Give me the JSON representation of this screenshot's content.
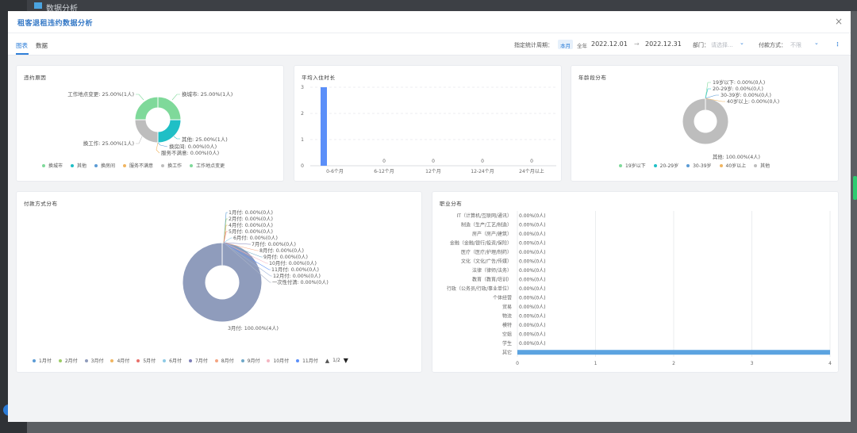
{
  "background": {
    "title": "数据分析"
  },
  "modal": {
    "title": "租客退租违约数据分析",
    "close": "×"
  },
  "toolbar": {
    "tabs": [
      "图表",
      "数据"
    ],
    "period_label": "指定统计周期：",
    "period_options": [
      "本月",
      "全年"
    ],
    "date_start": "2022.12.01",
    "date_arrow": "→",
    "date_end": "2022.12.31",
    "dept_label": "部门：",
    "dept_placeholder": "请选择...",
    "pay_label": "付款方式：",
    "pay_placeholder": "不限",
    "more": "⋮"
  },
  "colors": {
    "accent": "#2f7fd8",
    "teal": "#1fbfc6",
    "green": "#7fd99a",
    "gray": "#bdbdbd",
    "slate": "#8f9cbc",
    "blue": "#5b8ff9"
  },
  "cards": {
    "breach": {
      "title": "违约原因"
    },
    "avg_stay": {
      "title": "平均入住时长"
    },
    "age": {
      "title": "年龄段分布"
    },
    "payment": {
      "title": "付款方式分布"
    },
    "job": {
      "title": "职业分布"
    }
  },
  "chart_data": [
    {
      "type": "pie",
      "title": "违约原因",
      "slices": [
        {
          "name": "换城市",
          "value": 1,
          "label": "换城市: 25.00%(1人)",
          "color": "#7fd99a"
        },
        {
          "name": "其他",
          "value": 1,
          "label": "其他: 25.00%(1人)",
          "color": "#1fbfc6"
        },
        {
          "name": "换房间",
          "value": 0,
          "label": "换房间: 0.00%(0人)",
          "color": "#5b9bd5"
        },
        {
          "name": "服务不满意",
          "value": 0,
          "label": "服务不满意: 0.00%(0人)",
          "color": "#f0b560"
        },
        {
          "name": "换工作",
          "value": 1,
          "label": "换工作: 25.00%(1人)",
          "color": "#bdbdbd"
        },
        {
          "name": "工作地点变更",
          "value": 1,
          "label": "工作地点变更: 25.00%(1人)",
          "color": "#7fd99a"
        }
      ],
      "legend": [
        "换城市",
        "其他",
        "换房间",
        "服务不满意",
        "换工作",
        "工作地点变更"
      ]
    },
    {
      "type": "bar",
      "title": "平均入住时长",
      "categories": [
        "0-6个月",
        "6-12个月",
        "12个月",
        "12-24个月",
        "24个月以上"
      ],
      "values": [
        3,
        0,
        0,
        0,
        0
      ],
      "ylim": [
        0,
        3
      ],
      "yticks": [
        "0",
        "1",
        "2",
        "3"
      ],
      "color": "#5b8ff9"
    },
    {
      "type": "pie",
      "title": "年龄段分布",
      "slices": [
        {
          "name": "19岁以下",
          "value": 0,
          "label": "19岁以下: 0.00%(0人)",
          "color": "#7fd99a"
        },
        {
          "name": "20-29岁",
          "value": 0,
          "label": "20-29岁: 0.00%(0人)",
          "color": "#1fbfc6"
        },
        {
          "name": "30-39岁",
          "value": 0,
          "label": "30-39岁: 0.00%(0人)",
          "color": "#5b9bd5"
        },
        {
          "name": "40岁以上",
          "value": 0,
          "label": "40岁以上: 0.00%(0人)",
          "color": "#f0b560"
        },
        {
          "name": "其他",
          "value": 4,
          "label": "其他: 100.00%(4人)",
          "color": "#bdbdbd"
        }
      ],
      "legend": [
        "19岁以下",
        "20-29岁",
        "30-39岁",
        "40岁以上",
        "其他"
      ]
    },
    {
      "type": "pie",
      "title": "付款方式分布",
      "slices": [
        {
          "name": "1月付",
          "value": 0,
          "label": "1月付: 0.00%(0人)",
          "color": "#5b9bd5"
        },
        {
          "name": "2月付",
          "value": 0,
          "label": "2月付: 0.00%(0人)",
          "color": "#9ccc65"
        },
        {
          "name": "3月付",
          "value": 4,
          "label": "3月付: 100.00%(4人)",
          "color": "#8f9cbc"
        },
        {
          "name": "4月付",
          "value": 0,
          "label": "4月付: 0.00%(0人)",
          "color": "#f0b560"
        },
        {
          "name": "5月付",
          "value": 0,
          "label": "5月付: 0.00%(0人)",
          "color": "#e8706a"
        },
        {
          "name": "6月付",
          "value": 0,
          "label": "6月付: 0.00%(0人)",
          "color": "#8ecae6"
        },
        {
          "name": "7月付",
          "value": 0,
          "label": "7月付: 0.00%(0人)",
          "color": "#7e7fb8"
        },
        {
          "name": "8月付",
          "value": 0,
          "label": "8月付: 0.00%(0人)",
          "color": "#f4a582"
        },
        {
          "name": "9月付",
          "value": 0,
          "label": "9月付: 0.00%(0人)",
          "color": "#6fa8c8"
        },
        {
          "name": "10月付",
          "value": 0,
          "label": "10月付: 0.00%(0人)",
          "color": "#f4b6c2"
        },
        {
          "name": "11月付",
          "value": 0,
          "label": "11月付: 0.00%(0人)",
          "color": "#5b8ff9"
        },
        {
          "name": "12月付",
          "value": 0,
          "label": "12月付: 0.00%(0人)",
          "color": "#9bb0d6"
        },
        {
          "name": "一次性付清",
          "value": 0,
          "label": "一次性付清: 0.00%(0人)",
          "color": "#aab4c8"
        }
      ],
      "legend": [
        "1月付",
        "2月付",
        "3月付",
        "4月付",
        "5月付",
        "6月付",
        "7月付",
        "8月付",
        "9月付",
        "10月付",
        "11月付"
      ],
      "legend_page": "1/2"
    },
    {
      "type": "bar",
      "orientation": "horizontal",
      "title": "职业分布",
      "categories": [
        "IT（计算机/互联网/通讯）",
        "制造（生产/工艺/制造）",
        "房产（房产/建筑）",
        "金融（金融/银行/投资/保险）",
        "医疗（医疗/护理/制药）",
        "文化（文化/广告/传媒）",
        "法律（律师/法务）",
        "教育（教育/培训）",
        "行政（公务员/行政/事业单位）",
        "个体经营",
        "贸易",
        "物流",
        "模特",
        "空姐",
        "学生",
        "其它"
      ],
      "values": [
        0,
        0,
        0,
        0,
        0,
        0,
        0,
        0,
        0,
        0,
        0,
        0,
        0,
        0,
        0,
        4
      ],
      "labels": [
        "0.00%(0人)",
        "0.00%(0人)",
        "0.00%(0人)",
        "0.00%(0人)",
        "0.00%(0人)",
        "0.00%(0人)",
        "0.00%(0人)",
        "0.00%(0人)",
        "0.00%(0人)",
        "0.00%(0人)",
        "0.00%(0人)",
        "0.00%(0人)",
        "0.00%(0人)",
        "0.00%(0人)",
        "0.00%(0人)",
        ""
      ],
      "xlim": [
        0,
        4
      ],
      "xticks": [
        "0",
        "1",
        "2",
        "3",
        "4"
      ],
      "color": "#5ba3e0"
    }
  ]
}
